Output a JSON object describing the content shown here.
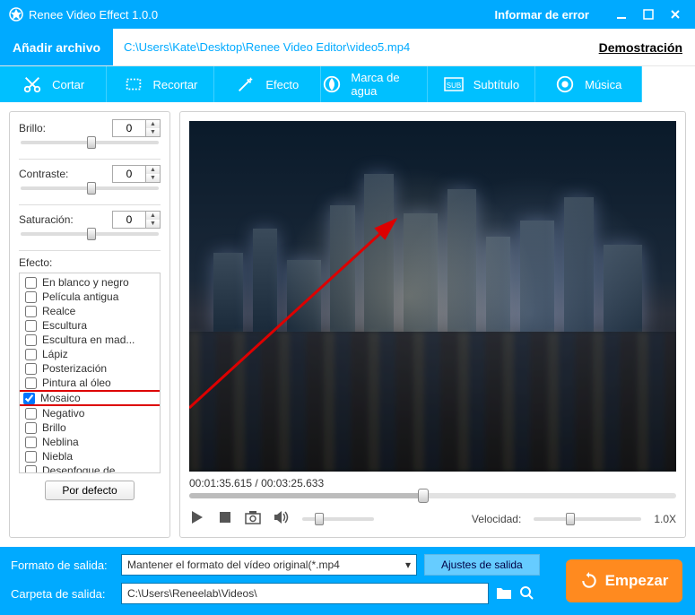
{
  "titlebar": {
    "title": "Renee Video Effect 1.0.0",
    "report": "Informar de error"
  },
  "filebar": {
    "add": "Añadir archivo",
    "path": "C:\\Users\\Kate\\Desktop\\Renee Video Editor\\video5.mp4",
    "demo": "Demostración"
  },
  "tabs": {
    "cut": "Cortar",
    "crop": "Recortar",
    "effect": "Efecto",
    "watermark": "Marca de agua",
    "subtitle": "Subtítulo",
    "music": "Música"
  },
  "left": {
    "brightness": {
      "label": "Brillo:",
      "value": "0"
    },
    "contrast": {
      "label": "Contraste:",
      "value": "0"
    },
    "saturation": {
      "label": "Saturación:",
      "value": "0"
    },
    "fx_label": "Efecto:",
    "fx": [
      "En blanco y negro",
      "Película antigua",
      "Realce",
      "Escultura",
      "Escultura en mad...",
      "Lápiz",
      "Posterización",
      "Pintura al óleo",
      "Mosaico",
      "Negativo",
      "Brillo",
      "Neblina",
      "Niebla",
      "Desenfoque de ..."
    ],
    "default_btn": "Por defecto"
  },
  "preview": {
    "time": "00:01:35.615 / 00:03:25.633",
    "speed_label": "Velocidad:",
    "speed_value": "1.0X"
  },
  "bottom": {
    "out_format_label": "Formato de salida:",
    "out_format_value": "Mantener el formato del vídeo original(*.mp4",
    "settings": "Ajustes de salida",
    "out_folder_label": "Carpeta de salida:",
    "out_folder_value": "C:\\Users\\Reneelab\\Videos\\",
    "start": "Empezar"
  }
}
